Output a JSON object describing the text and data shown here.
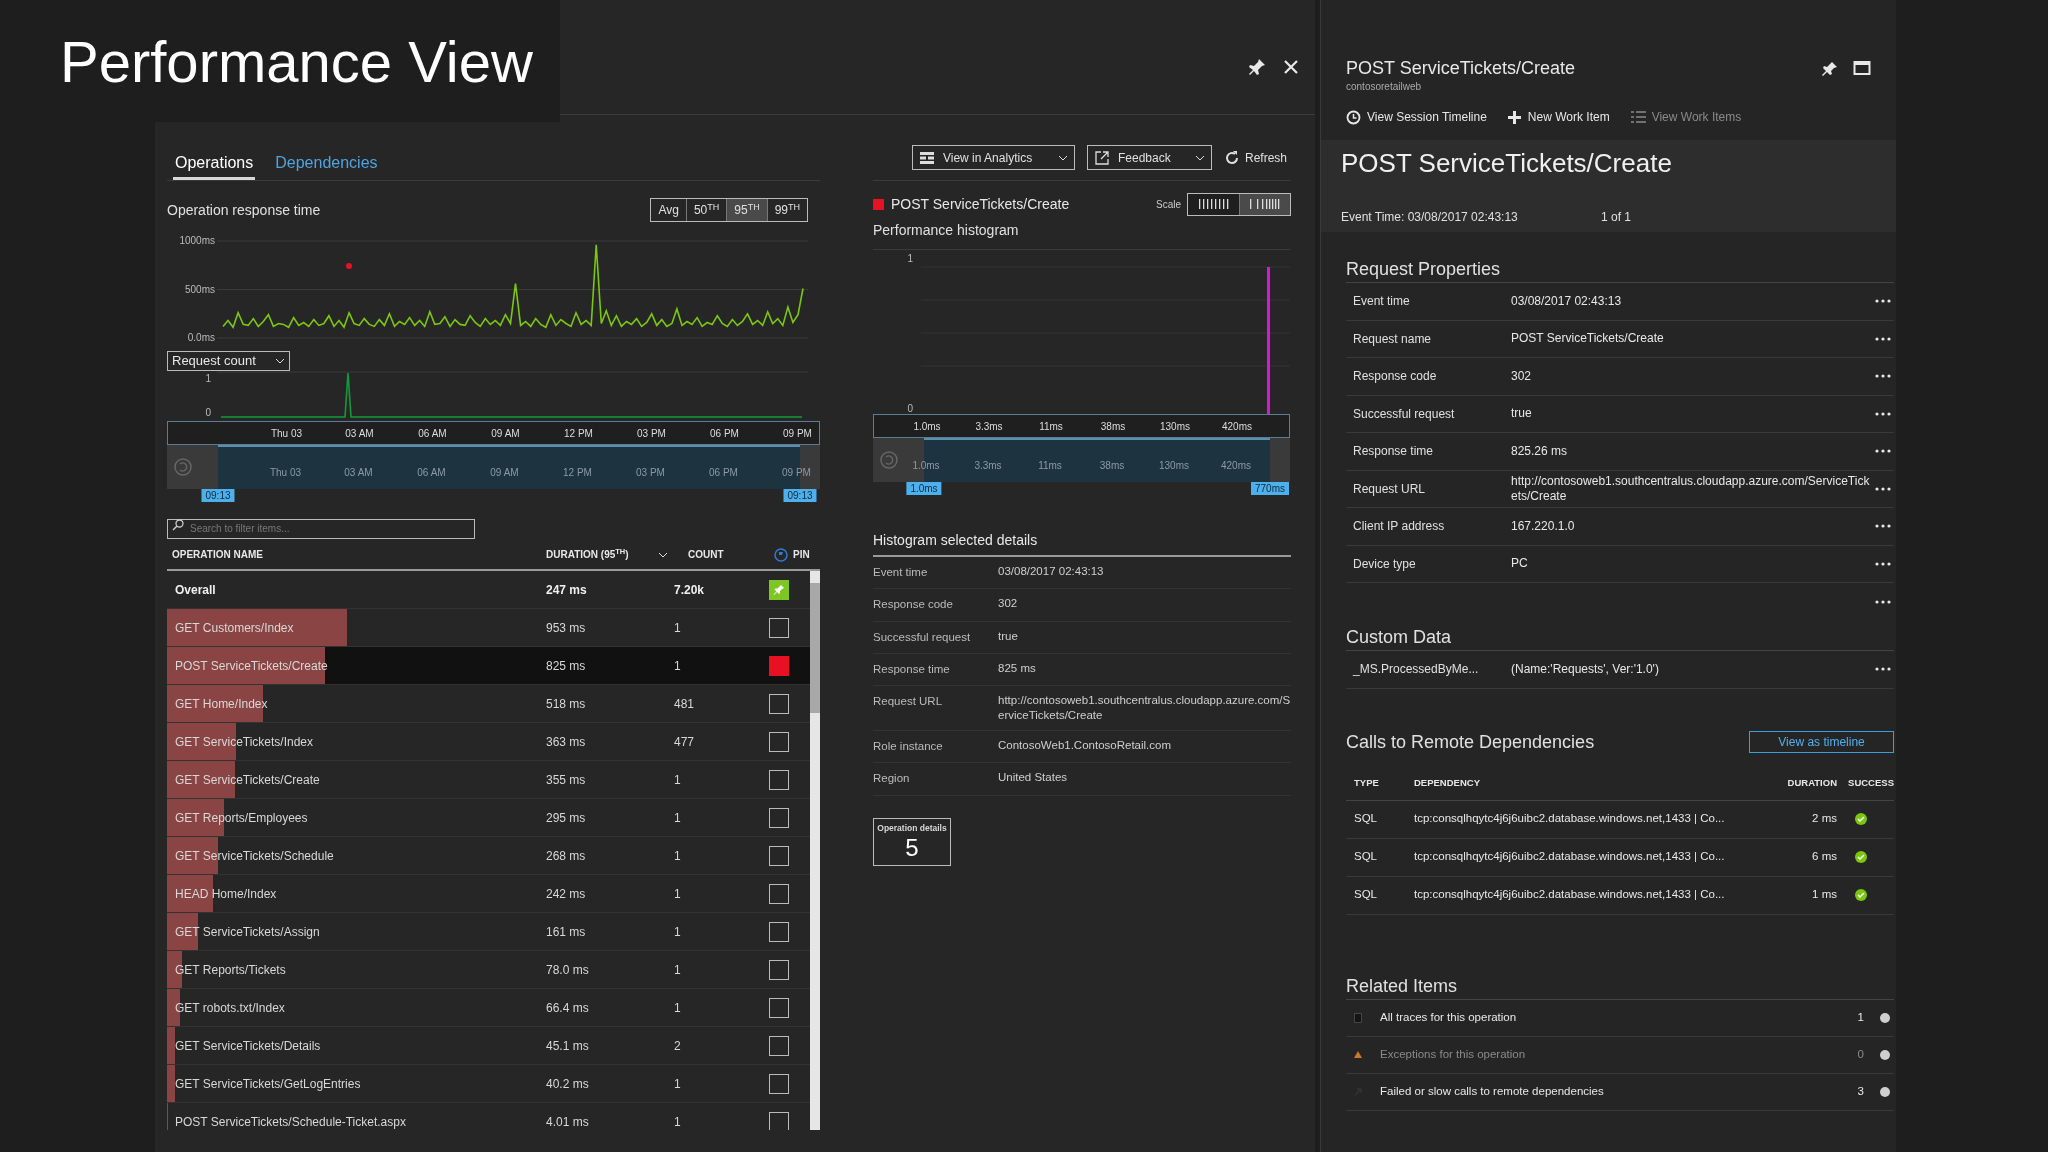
{
  "overlay_title": "Performance View",
  "left_blade": {
    "tabs": [
      {
        "label": "Operations",
        "selected": true
      },
      {
        "label": "Dependencies",
        "selected": false
      }
    ],
    "toolbar": [
      {
        "label": "View in Analytics",
        "kind": "analytics"
      },
      {
        "label": "Feedback",
        "kind": "feedback"
      },
      {
        "label": "Refresh",
        "kind": "refresh"
      }
    ],
    "response_chart": {
      "title": "Operation response time",
      "percentiles": [
        {
          "label": "Avg",
          "selected": false
        },
        {
          "label": "50$^{TH}$",
          "selected": false
        },
        {
          "label": "95$^{TH}$",
          "selected": true
        },
        {
          "label": "99$^{TH}$",
          "selected": false
        }
      ],
      "chart_data": {
        "type": "line",
        "ylim": [
          0,
          1000
        ],
        "yticks": [
          {
            "value": 1000,
            "label": "1000ms"
          },
          {
            "value": 500,
            "label": "500ms"
          },
          {
            "value": 0,
            "label": "0.0ms"
          }
        ],
        "series": [
          {
            "color": "#7ac70c",
            "values": [
              120,
              180,
              110,
              260,
              140,
              130,
              200,
              120,
              170,
              240,
              120,
              150,
              140,
              110,
              210,
              130,
              160,
              120,
              190,
              130,
              150,
              230,
              120,
              180,
              110,
              260,
              150,
              130,
              200,
              140,
              120,
              190,
              130,
              250,
              120,
              170,
              140,
              210,
              130,
              180,
              120,
              270,
              140,
              150,
              220,
              120,
              190,
              140,
              130,
              230,
              160,
              120,
              200,
              140,
              180,
              130,
              240,
              150,
              560,
              130,
              170,
              120,
              200,
              140,
              110,
              240,
              130,
              190,
              150,
              120,
              260,
              140,
              180,
              130,
              960,
              150,
              280,
              130,
              230,
              120,
              170,
              140,
              200,
              120,
              160,
              250,
              130,
              190,
              120,
              150,
              300,
              130,
              170,
              140,
              210,
              120,
              160,
              140,
              230,
              150,
              120,
              190,
              130,
              170,
              250,
              140,
              180,
              130,
              270,
              150,
              200,
              130,
              320,
              160,
              240,
              510
            ]
          }
        ]
      }
    },
    "metric_dropdown": "Request count",
    "count_labels": [
      "1",
      "0"
    ],
    "time_labels": [
      "Thu 03",
      "03 AM",
      "06 AM",
      "09 AM",
      "12 PM",
      "03 PM",
      "06 PM",
      "09 PM"
    ],
    "brush_time_labels": [
      "Thu 03",
      "03 AM",
      "06 AM",
      "09 AM",
      "12 PM",
      "03 PM",
      "06 PM",
      "09 PM"
    ],
    "brush_handles": [
      "09:13",
      "09:13"
    ],
    "search": {
      "placeholder": "Search to filter items..."
    },
    "table": {
      "columns": [
        "OPERATION NAME",
        "DURATION (95$^{TH}$)",
        "COUNT",
        "PIN"
      ],
      "rows": [
        {
          "kind": "total",
          "name": "Overall",
          "duration": "247 ms",
          "count": "7.20k",
          "pinned": true,
          "color": "#7dc623",
          "selected": false
        },
        {
          "kind": "operation",
          "name": "GET Customers/Index",
          "duration": "953 ms",
          "count": "1",
          "level": 0.28,
          "pinned": false,
          "selected": false
        },
        {
          "kind": "operation",
          "name": "POST ServiceTickets/Create",
          "duration": "825 ms",
          "count": "1",
          "level": 0.245,
          "pinned": true,
          "color": "#e81123",
          "selected": true
        },
        {
          "kind": "operation",
          "name": "GET Home/Index",
          "duration": "518 ms",
          "count": "481",
          "level": 0.15,
          "pinned": false,
          "selected": false
        },
        {
          "kind": "operation",
          "name": "GET ServiceTickets/Index",
          "duration": "363 ms",
          "count": "477",
          "level": 0.108,
          "pinned": false,
          "selected": false
        },
        {
          "kind": "operation",
          "name": "GET ServiceTickets/Create",
          "duration": "355 ms",
          "count": "1",
          "level": 0.106,
          "pinned": false,
          "selected": false
        },
        {
          "kind": "operation",
          "name": "GET Reports/Employees",
          "duration": "295 ms",
          "count": "1",
          "level": 0.088,
          "pinned": false,
          "selected": false
        },
        {
          "kind": "operation",
          "name": "GET ServiceTickets/Schedule",
          "duration": "268 ms",
          "count": "1",
          "level": 0.08,
          "pinned": false,
          "selected": false
        },
        {
          "kind": "operation",
          "name": "HEAD Home/Index",
          "duration": "242 ms",
          "count": "1",
          "level": 0.072,
          "pinned": false,
          "selected": false
        },
        {
          "kind": "operation",
          "name": "GET ServiceTickets/Assign",
          "duration": "161 ms",
          "count": "1",
          "level": 0.048,
          "pinned": false,
          "selected": false
        },
        {
          "kind": "operation",
          "name": "GET Reports/Tickets",
          "duration": "78.0 ms",
          "count": "1",
          "level": 0.023,
          "pinned": false,
          "selected": false
        },
        {
          "kind": "operation",
          "name": "GET robots.txt/Index",
          "duration": "66.4 ms",
          "count": "1",
          "level": 0.02,
          "pinned": false,
          "selected": false
        },
        {
          "kind": "operation",
          "name": "GET ServiceTickets/Details",
          "duration": "45.1 ms",
          "count": "2",
          "level": 0.013,
          "pinned": false,
          "selected": false
        },
        {
          "kind": "operation",
          "name": "GET ServiceTickets/GetLogEntries",
          "duration": "40.2 ms",
          "count": "1",
          "level": 0.012,
          "pinned": false,
          "selected": false
        },
        {
          "kind": "operation",
          "name": "POST ServiceTickets/Schedule-Ticket.aspx",
          "duration": "4.01 ms",
          "count": "1",
          "level": 0.001,
          "pinned": false,
          "selected": false
        }
      ]
    },
    "selection": {
      "label": "POST ServiceTickets/Create",
      "color": "#e81123"
    },
    "scale_label": "Scale",
    "scale_options": [
      {
        "selected": false
      },
      {
        "selected": true
      }
    ],
    "histogram": {
      "title": "Performance histogram",
      "y_labels": [
        "1",
        "0"
      ],
      "x_labels": [
        "1.0ms",
        "3.3ms",
        "11ms",
        "38ms",
        "130ms",
        "420ms"
      ],
      "brush_x_labels": [
        "1.0ms",
        "3.3ms",
        "11ms",
        "38ms",
        "130ms",
        "420ms"
      ],
      "brush_handles": [
        "1.0ms",
        "770ms"
      ]
    },
    "details_title": "Histogram selected details",
    "details": [
      {
        "label": "Event time",
        "value": "03/08/2017 02:43:13"
      },
      {
        "label": "Response code",
        "value": "302"
      },
      {
        "label": "Successful request",
        "value": "true"
      },
      {
        "label": "Response time",
        "value": "825 ms"
      },
      {
        "label": "Request URL",
        "value": "http://contosoweb1.southcentralus.cloudapp.azure.com/ServiceTickets/Create"
      },
      {
        "label": "Role instance",
        "value": "ContosoWeb1.ContosoRetail.com"
      },
      {
        "label": "Region",
        "value": "United States"
      }
    ],
    "operation_details": {
      "label": "Operation details",
      "count": "5"
    }
  },
  "right_blade": {
    "title": "POST ServiceTickets/Create",
    "subtitle": "contosoretailweb",
    "commands": [
      {
        "label": "View Session Timeline",
        "kind": "timeline",
        "disabled": false
      },
      {
        "label": "New Work Item",
        "kind": "add",
        "disabled": false
      },
      {
        "label": "View Work Items",
        "kind": "list",
        "disabled": true
      }
    ],
    "heading": "POST ServiceTickets/Create",
    "event_time": "Event Time: 03/08/2017 02:43:13",
    "pager": "1 of 1",
    "request_properties": {
      "title": "Request Properties",
      "trailing_menu": true,
      "rows": [
        {
          "label": "Event time",
          "value": "03/08/2017 02:43:13"
        },
        {
          "label": "Request name",
          "value": "POST ServiceTickets/Create"
        },
        {
          "label": "Response code",
          "value": "302"
        },
        {
          "label": "Successful request",
          "value": "true"
        },
        {
          "label": "Response time",
          "value": "825.26 ms"
        },
        {
          "label": "Request URL",
          "value": "http://contosoweb1.southcentralus.cloudapp.azure.com/ServiceTickets/Create"
        },
        {
          "label": "Client IP address",
          "value": "167.220.1.0"
        },
        {
          "label": "Device type",
          "value": "PC"
        }
      ]
    },
    "custom_data": {
      "title": "Custom Data",
      "rows": [
        {
          "label": "_MS.ProcessedByMe...",
          "value": "(Name:'Requests', Ver:'1.0')"
        }
      ]
    },
    "dependencies": {
      "title": "Calls to Remote Dependencies",
      "button": "View as timeline",
      "columns": [
        "TYPE",
        "DEPENDENCY",
        "DURATION",
        "SUCCESS"
      ],
      "rows": [
        {
          "type": "SQL",
          "dependency": "tcp:consqlhqytc4j6j6uibc2.database.windows.net,1433 | Co...",
          "duration": "2 ms",
          "success": true
        },
        {
          "type": "SQL",
          "dependency": "tcp:consqlhqytc4j6j6uibc2.database.windows.net,1433 | Co...",
          "duration": "6 ms",
          "success": true
        },
        {
          "type": "SQL",
          "dependency": "tcp:consqlhqytc4j6j6uibc2.database.windows.net,1433 | Co...",
          "duration": "1 ms",
          "success": true
        }
      ]
    },
    "related": {
      "title": "Related Items",
      "rows": [
        {
          "kind": "traces",
          "label": "All traces for this operation",
          "count": "1",
          "disabled": false
        },
        {
          "kind": "exceptions",
          "label": "Exceptions for this operation",
          "count": "0",
          "disabled": true
        },
        {
          "kind": "dependencies",
          "label": "Failed or slow calls to remote dependencies",
          "count": "3",
          "disabled": false
        }
      ]
    }
  }
}
